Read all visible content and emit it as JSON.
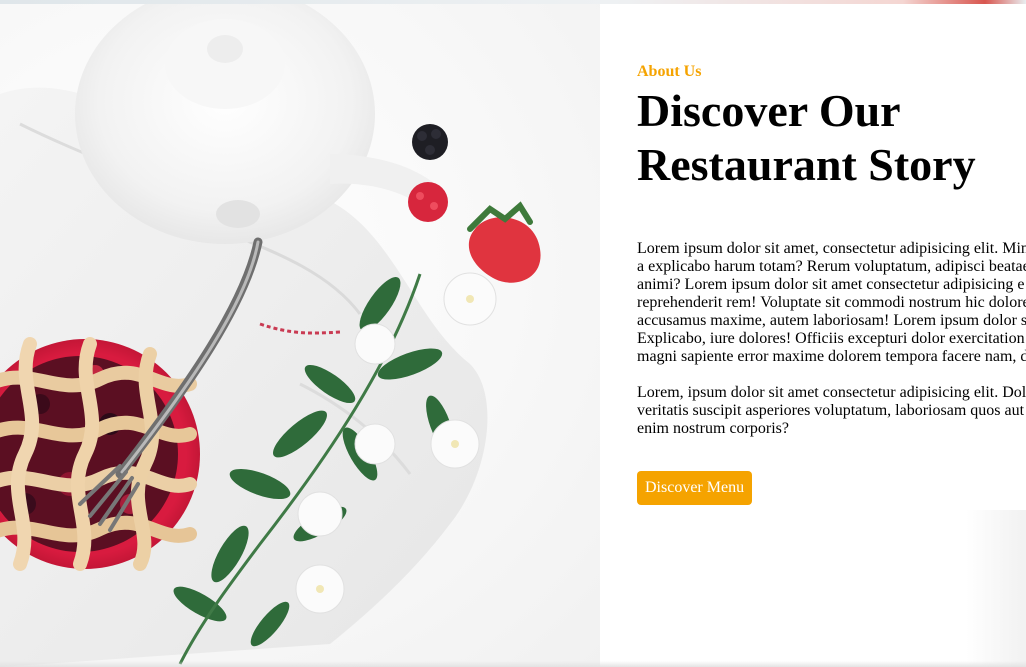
{
  "about": {
    "eyebrow": "About Us",
    "title": "Discover Our Restaurant Story",
    "paragraph1_lines": [
      "Lorem ipsum dolor sit amet, consectetur adipisicing elit. Min",
      "a explicabo harum totam? Rerum voluptatum, adipisci beatae",
      "animi? Lorem ipsum dolor sit amet consectetur adipisicing e",
      "reprehenderit rem! Voluptate sit commodi nostrum hic dolore",
      "accusamus maxime, autem laboriosam! Lorem ipsum dolor s",
      "Explicabo, iure dolores! Officiis excepturi dolor exercitation",
      "magni sapiente error maxime dolorem tempora facere nam, d"
    ],
    "paragraph2_lines": [
      "Lorem, ipsum dolor sit amet consectetur adipisicing elit. Dol",
      "veritatis suscipit asperiores voluptatum, laboriosam quos aut",
      "enim nostrum corporis?"
    ],
    "button_label": "Discover Menu"
  },
  "colors": {
    "accent": "#f5a300",
    "text": "#000000",
    "background": "#ffffff"
  },
  "hero_image": {
    "subject": "overhead view of a berry lattice pie in a red dish with a fork, white teapot, linen napkin, strawberries, blackberry and white flowers with green leaves"
  }
}
